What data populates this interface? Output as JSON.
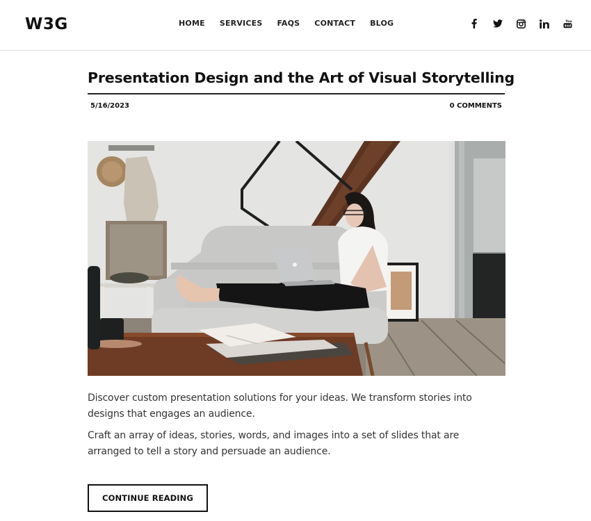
{
  "header": {
    "logo": "W3G",
    "nav": [
      {
        "label": "HOME"
      },
      {
        "label": "SERVICES"
      },
      {
        "label": "FAQS"
      },
      {
        "label": "CONTACT"
      },
      {
        "label": "BLOG"
      }
    ],
    "social": [
      {
        "icon": "facebook-icon"
      },
      {
        "icon": "twitter-icon"
      },
      {
        "icon": "instagram-icon"
      },
      {
        "icon": "linkedin-icon"
      },
      {
        "icon": "youtube-icon"
      }
    ]
  },
  "article": {
    "title": "Presentation Design and the Art of Visual Storytelling",
    "date": "5/16/2023",
    "comments": "0 COMMENTS",
    "image_alt": "Woman sitting on a grey sofa working on a laptop in a bright living room",
    "paragraphs": [
      "Discover custom presentation solutions for your ideas. We transform stories into designs that engages an audience.",
      "Craft an array of ideas, stories, words, and images into a set of slides that are arranged to tell a story and persuade an audience."
    ],
    "cta_label": "CONTINUE READING"
  }
}
